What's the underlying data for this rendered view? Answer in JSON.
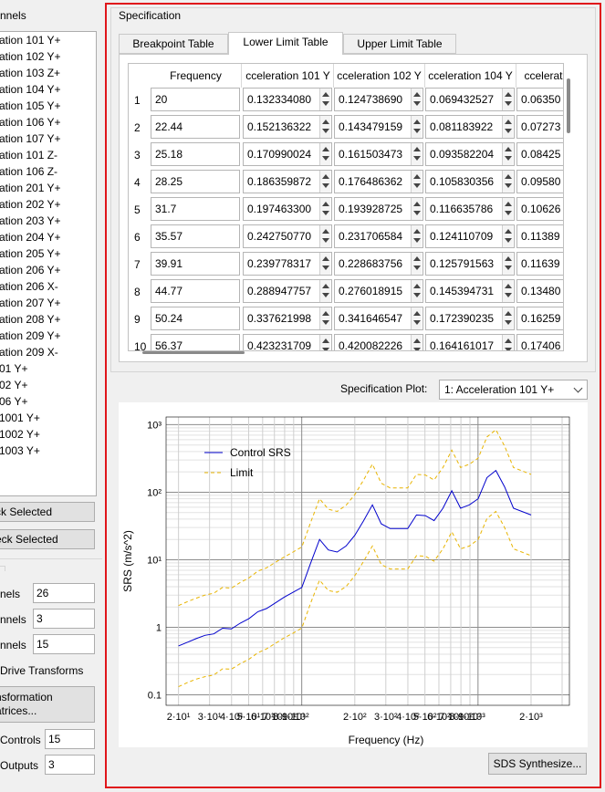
{
  "left_panel": {
    "group_title": "nnels",
    "channels": [
      "ation 101 Y+",
      "ation 102 Y+",
      "ation 103 Z+",
      "ation 104 Y+",
      "ation 105 Y+",
      "ation 106 Y+",
      "ation 107 Y+",
      "ation 101 Z-",
      "ation 106 Z-",
      "ation 201 Y+",
      "ation 202 Y+",
      "ation 203 Y+",
      "ation 204 Y+",
      "ation 205 Y+",
      "ation 206 Y+",
      "ation 206 X-",
      "ation 207 Y+",
      "ation 208 Y+",
      "ation 209 Y+",
      "ation 209 X-",
      "01 Y+",
      "02 Y+",
      "06 Y+",
      " 1001 Y+",
      " 1002 Y+",
      " 1003 Y+"
    ],
    "check_selected": "ck Selected",
    "uncheck_selected": "eck Selected",
    "stats": [
      {
        "label": "nels",
        "value": "26"
      },
      {
        "label": "nnels",
        "value": "3"
      },
      {
        "label": "nnels",
        "value": "15"
      }
    ],
    "drive_transforms_title": " Drive Transforms",
    "transformation_button": "nsformation\natrices...",
    "controls_label": "Controls",
    "controls_value": "15",
    "outputs_label": "Outputs",
    "outputs_value": "3"
  },
  "spec": {
    "title": "Specification",
    "tabs": [
      "Breakpoint Table",
      "Lower Limit Table",
      "Upper Limit Table"
    ],
    "selected_tab": "Lower Limit Table",
    "columns": [
      "Frequency",
      "cceleration 101 Y",
      "cceleration 102 Y",
      "cceleration 104 Y",
      "ccelerat"
    ],
    "rows": [
      {
        "n": "1",
        "f": "20",
        "v": [
          "0.132334080",
          "0.124738690",
          "0.069432527",
          "0.06350"
        ]
      },
      {
        "n": "2",
        "f": "22.44",
        "v": [
          "0.152136322",
          "0.143479159",
          "0.081183922",
          "0.07273"
        ]
      },
      {
        "n": "3",
        "f": "25.18",
        "v": [
          "0.170990024",
          "0.161503473",
          "0.093582204",
          "0.08425"
        ]
      },
      {
        "n": "4",
        "f": "28.25",
        "v": [
          "0.186359872",
          "0.176486362",
          "0.105830356",
          "0.09580"
        ]
      },
      {
        "n": "5",
        "f": "31.7",
        "v": [
          "0.197463300",
          "0.193928725",
          "0.116635786",
          "0.10626"
        ]
      },
      {
        "n": "6",
        "f": "35.57",
        "v": [
          "0.242750770",
          "0.231706584",
          "0.124110709",
          "0.11389"
        ]
      },
      {
        "n": "7",
        "f": "39.91",
        "v": [
          "0.239778317",
          "0.228683756",
          "0.125791563",
          "0.11639"
        ]
      },
      {
        "n": "8",
        "f": "44.77",
        "v": [
          "0.288947757",
          "0.276018915",
          "0.145394731",
          "0.13480"
        ]
      },
      {
        "n": "9",
        "f": "50.24",
        "v": [
          "0.337621998",
          "0.341646547",
          "0.172390235",
          "0.16259"
        ]
      },
      {
        "n": "10",
        "f": "56.37",
        "v": [
          "0.423231709",
          "0.420082226",
          "0.164161017",
          "0.17406"
        ]
      }
    ],
    "plot_label": "Specification Plot:",
    "plot_selection": "1: Acceleration 101 Y+",
    "sds_button": "SDS Synthesize..."
  },
  "chart_data": {
    "type": "line",
    "xlabel": "Frequency (Hz)",
    "ylabel": "SRS (m/s^2)",
    "xscale": "log",
    "yscale": "log",
    "xlim": [
      17,
      3300
    ],
    "ylim": [
      0.07,
      1300
    ],
    "xtick_labels": [
      "2·10¹",
      "3·10¹",
      "4·10¹",
      "5·10¹",
      "6·10¹",
      "7·10¹",
      "8·10¹",
      "9·10¹",
      "10²",
      "2·10²",
      "3·10²",
      "4·10²",
      "5·10²",
      "6·10²",
      "7·10²",
      "8·10²",
      "9·10²",
      "10³",
      "2·10³"
    ],
    "ytick_labels": [
      "0.1",
      "1",
      "10¹",
      "10²",
      "10³"
    ],
    "legend_position": "top-left",
    "grid": true,
    "series": [
      {
        "name": "Control SRS",
        "color": "#0000cc",
        "style": "solid",
        "x": [
          20,
          22.44,
          25.18,
          28.25,
          31.7,
          35.57,
          39.91,
          44.77,
          50.24,
          56.37,
          63.25,
          70.96,
          79.62,
          89.34,
          100.2,
          112.5,
          126.2,
          141.6,
          158.9,
          178.3,
          200,
          224.4,
          251.8,
          282.5,
          317,
          355.7,
          399.1,
          447.7,
          502.4,
          563.7,
          632.5,
          709.6,
          796.2,
          893.4,
          1002,
          1125,
          1262,
          1416,
          1589,
          2000
        ],
        "y": [
          0.53,
          0.6,
          0.68,
          0.76,
          0.8,
          0.97,
          0.95,
          1.15,
          1.35,
          1.7,
          1.9,
          2.3,
          2.8,
          3.3,
          3.9,
          9,
          20,
          14,
          13,
          16,
          23,
          38,
          65,
          34,
          29,
          29,
          29,
          46,
          45,
          38,
          58,
          105,
          58,
          65,
          80,
          165,
          210,
          120,
          58,
          46
        ]
      },
      {
        "name": "Limit",
        "color": "#e8b400",
        "style": "dashed",
        "x": [
          20,
          22.44,
          25.18,
          28.25,
          31.7,
          35.57,
          39.91,
          44.77,
          50.24,
          56.37,
          63.25,
          70.96,
          79.62,
          89.34,
          100.2,
          112.5,
          126.2,
          141.6,
          158.9,
          178.3,
          200,
          224.4,
          251.8,
          282.5,
          317,
          355.7,
          399.1,
          447.7,
          502.4,
          563.7,
          632.5,
          709.6,
          796.2,
          893.4,
          1002,
          1125,
          1262,
          1416,
          1589,
          2000
        ],
        "y": [
          2.1,
          2.4,
          2.7,
          3.0,
          3.2,
          3.9,
          3.8,
          4.6,
          5.4,
          6.8,
          7.6,
          9.2,
          11,
          13,
          15.5,
          36,
          80,
          56,
          52,
          64,
          92,
          152,
          260,
          136,
          116,
          116,
          116,
          184,
          180,
          152,
          232,
          420,
          232,
          260,
          320,
          660,
          840,
          480,
          232,
          184
        ]
      },
      {
        "name": "",
        "color": "#e8b400",
        "style": "dashed",
        "x": [
          20,
          22.44,
          25.18,
          28.25,
          31.7,
          35.57,
          39.91,
          44.77,
          50.24,
          56.37,
          63.25,
          70.96,
          79.62,
          89.34,
          100.2,
          112.5,
          126.2,
          141.6,
          158.9,
          178.3,
          200,
          224.4,
          251.8,
          282.5,
          317,
          355.7,
          399.1,
          447.7,
          502.4,
          563.7,
          632.5,
          709.6,
          796.2,
          893.4,
          1002,
          1125,
          1262,
          1416,
          1589,
          2000
        ],
        "y": [
          0.132,
          0.152,
          0.171,
          0.186,
          0.197,
          0.243,
          0.24,
          0.289,
          0.338,
          0.42,
          0.48,
          0.58,
          0.7,
          0.82,
          0.98,
          2.3,
          5,
          3.5,
          3.3,
          4,
          5.8,
          9.5,
          16,
          8.5,
          7.3,
          7.3,
          7.3,
          11.5,
          11.3,
          9.5,
          14.5,
          26,
          14.5,
          16,
          20,
          41,
          52,
          30,
          14.5,
          11.5
        ]
      }
    ]
  }
}
